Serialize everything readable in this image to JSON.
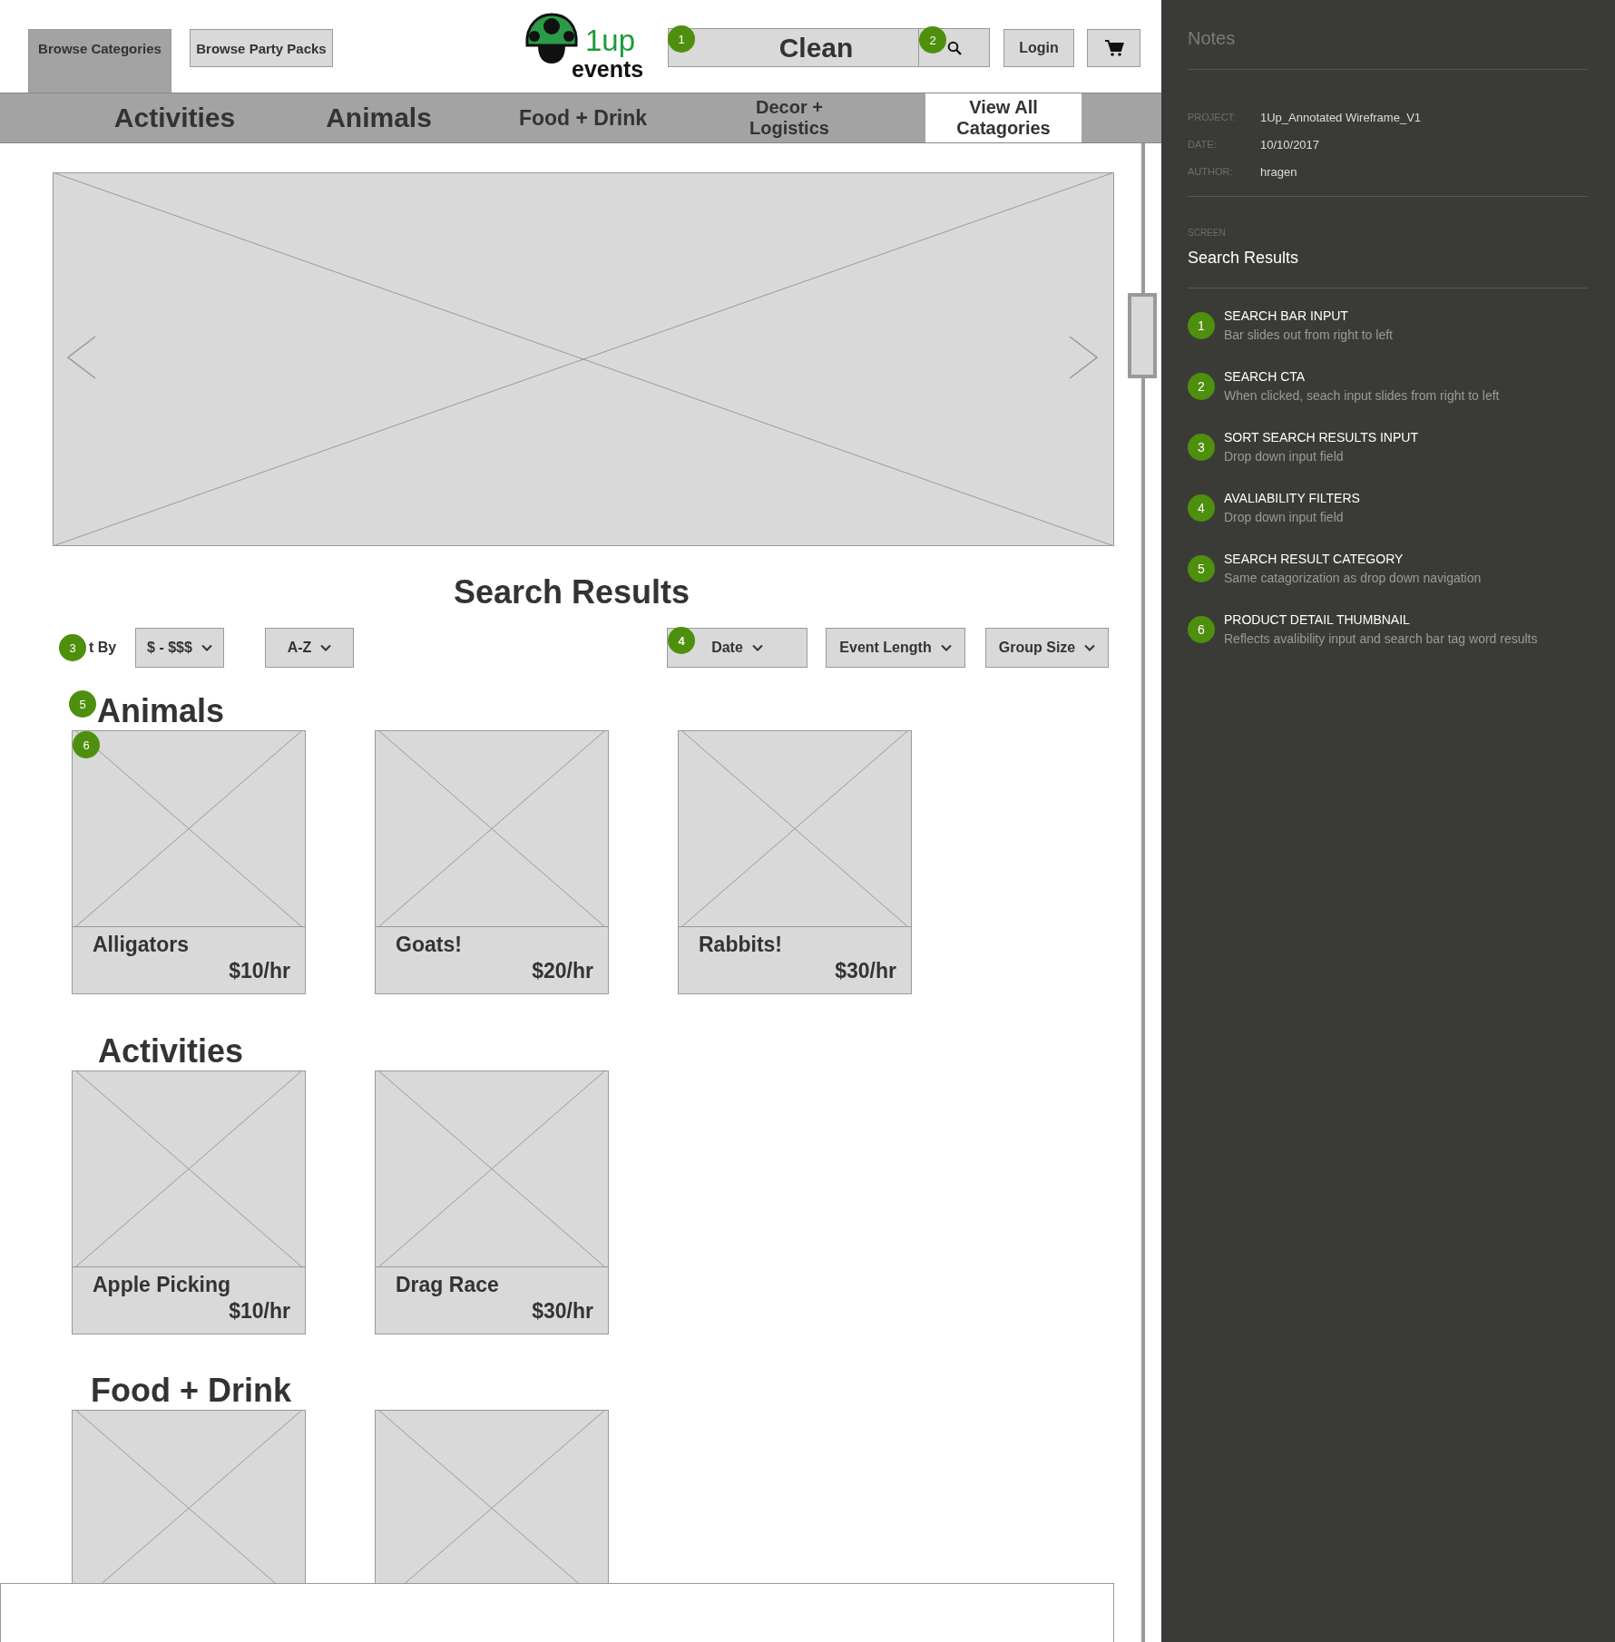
{
  "header": {
    "tabs": [
      {
        "label": "Browse Categories",
        "selected": true
      },
      {
        "label": "Browse Party Packs",
        "selected": false
      }
    ],
    "logo": {
      "number": "1up",
      "word": "events"
    },
    "search": {
      "value": "Clean",
      "badge": "1"
    },
    "search_button": {
      "badge": "2"
    },
    "login": "Login"
  },
  "nav": [
    {
      "label": "Activities",
      "selected": false
    },
    {
      "label": "Animals",
      "selected": false
    },
    {
      "label": "Food + Drink",
      "selected": false
    },
    {
      "label": "Decor + Logistics",
      "selected": false
    },
    {
      "label": "View All Catagories",
      "selected": true
    }
  ],
  "results": {
    "title": "Search Results",
    "sort": {
      "badge": "3",
      "label": "t By",
      "dropdowns": [
        "$ - $$$",
        "A-Z"
      ]
    },
    "filters": {
      "badge": "4",
      "dropdowns": [
        "Date",
        "Event Length",
        "Group Size"
      ]
    },
    "categories": [
      {
        "name": "Animals",
        "badge": "5",
        "items": [
          {
            "kind": "product",
            "name": "Alligators",
            "price": "$10/hr",
            "badge": "6"
          },
          {
            "kind": "product",
            "name": "Goats!",
            "price": "$20/hr"
          },
          {
            "kind": "product",
            "name": "Rabbits!",
            "price": "$30/hr"
          }
        ]
      },
      {
        "name": "Activities",
        "items": [
          {
            "kind": "product",
            "name": "Apple Picking",
            "price": "$10/hr"
          },
          {
            "kind": "product",
            "name": "Drag Race",
            "price": "$30/hr"
          }
        ]
      },
      {
        "name": "Food + Drink",
        "items": [
          {
            "kind": "product"
          },
          {
            "kind": "product"
          }
        ]
      }
    ]
  },
  "notes": {
    "title": "Notes",
    "meta": [
      {
        "label": "PROJECT:",
        "value": "1Up_Annotated Wireframe_V1"
      },
      {
        "label": "DATE:",
        "value": "10/10/2017"
      },
      {
        "label": "AUTHOR:",
        "value": "hragen"
      }
    ],
    "screen_label": "SCREEN",
    "screen": "Search Results",
    "items": [
      {
        "number": "1",
        "title": "SEARCH BAR INPUT",
        "description": "Bar slides out from right to left"
      },
      {
        "number": "2",
        "title": "SEARCH CTA",
        "description": "When clicked, seach input slides from right to left"
      },
      {
        "number": "3",
        "title": "SORT SEARCH RESULTS INPUT",
        "description": "Drop down input field"
      },
      {
        "number": "4",
        "title": "AVALIABILITY FILTERS",
        "description": "Drop down input field"
      },
      {
        "number": "5",
        "title": "SEARCH RESULT CATEGORY",
        "description": "Same catagorization as drop down navigation"
      },
      {
        "number": "6",
        "title": "PRODUCT DETAIL THUMBNAIL",
        "description": "Reflects avalibility input and search bar tag word results"
      }
    ]
  }
}
